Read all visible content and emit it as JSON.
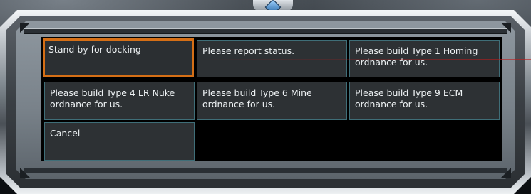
{
  "dialog": {
    "options": [
      {
        "label": "Stand by for docking",
        "selected": true
      },
      {
        "label": "Please report status.",
        "selected": false
      },
      {
        "label": "Please build Type 1 Homing\nordnance for us.",
        "selected": false
      },
      {
        "label": "Please build Type 4 LR Nuke\nordnance for us.",
        "selected": false
      },
      {
        "label": "Please build Type 6 Mine\nordnance for us.",
        "selected": false
      },
      {
        "label": "Please build Type 9 ECM\nordnance for us.",
        "selected": false
      },
      {
        "label": "Cancel",
        "selected": false
      }
    ]
  },
  "colors": {
    "selection_border": "#d56f16",
    "option_border": "#3f6e78",
    "option_fill": "#2d3134",
    "pointer_line": "#c21a1a",
    "gem": "#2f7fd0"
  }
}
